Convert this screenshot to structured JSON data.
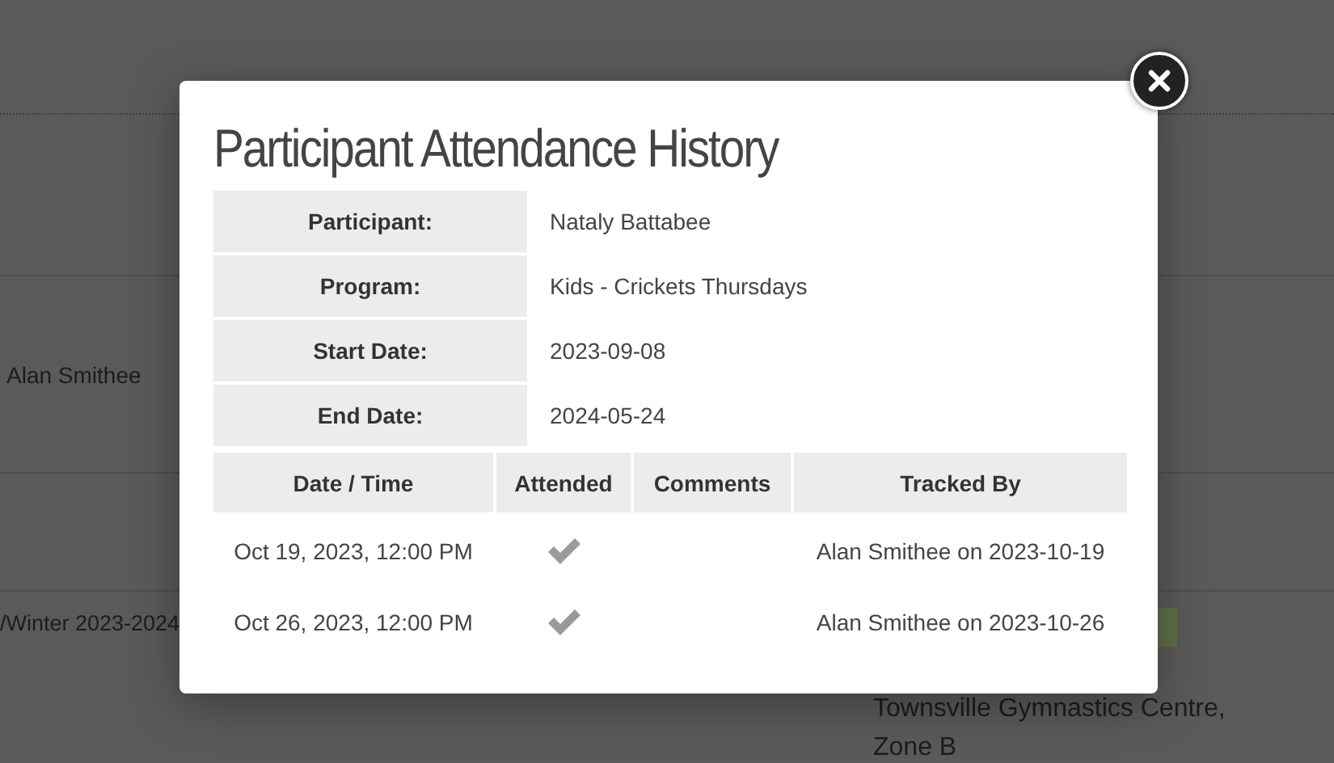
{
  "background": {
    "tracker_name": "Alan Smithee",
    "season": "/Winter 2023-2024",
    "location": "Townsville Gymnastics Centre, Zone B"
  },
  "dialog": {
    "title": "Participant Attendance History",
    "details": [
      {
        "label": "Participant:",
        "value": "Nataly Battabee"
      },
      {
        "label": "Program:",
        "value": "Kids - Crickets Thursdays"
      },
      {
        "label": "Start Date:",
        "value": "2023-09-08"
      },
      {
        "label": "End Date:",
        "value": "2024-05-24"
      }
    ],
    "history": {
      "columns": [
        "Date / Time",
        "Attended",
        "Comments",
        "Tracked By"
      ],
      "rows": [
        {
          "date_time": "Oct 19, 2023, 12:00 PM",
          "attended": true,
          "tracked_by": "Alan Smithee on 2023-10-19"
        },
        {
          "date_time": "Oct 26, 2023, 12:00 PM",
          "attended": true,
          "tracked_by": "Alan Smithee on 2023-10-26"
        }
      ]
    }
  }
}
